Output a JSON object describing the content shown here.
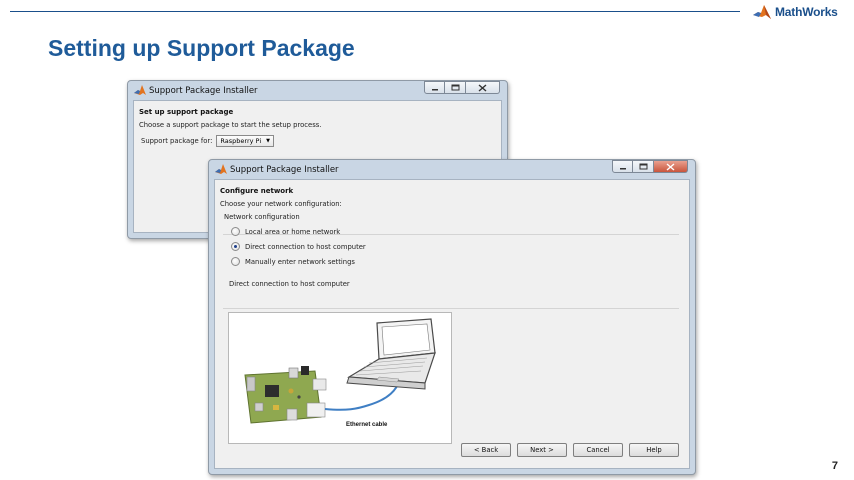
{
  "slide": {
    "title": "Setting up Support Package",
    "brand": "MathWorks",
    "page_number": "7"
  },
  "window_back": {
    "title": "Support Package Installer",
    "heading": "Set up support package",
    "instruction": "Choose a support package to start the setup process.",
    "package_label": "Support package for:",
    "package_value": "Raspberry Pi"
  },
  "window_front": {
    "title": "Support Package Installer",
    "heading": "Configure network",
    "instruction": "Choose your network configuration:",
    "group_label": "Network configuration",
    "options": [
      {
        "label": "Local area or home network",
        "selected": false
      },
      {
        "label": "Direct connection to host computer",
        "selected": true
      },
      {
        "label": "Manually enter network settings",
        "selected": false
      }
    ],
    "section_label": "Direct connection to host computer",
    "cable_label": "Ethernet cable",
    "buttons": {
      "back": "< Back",
      "next": "Next >",
      "cancel": "Cancel",
      "help": "Help"
    }
  },
  "colors": {
    "title_blue": "#1f5b99",
    "board_green": "#8fa850",
    "cable_blue": "#3f7fc4"
  }
}
